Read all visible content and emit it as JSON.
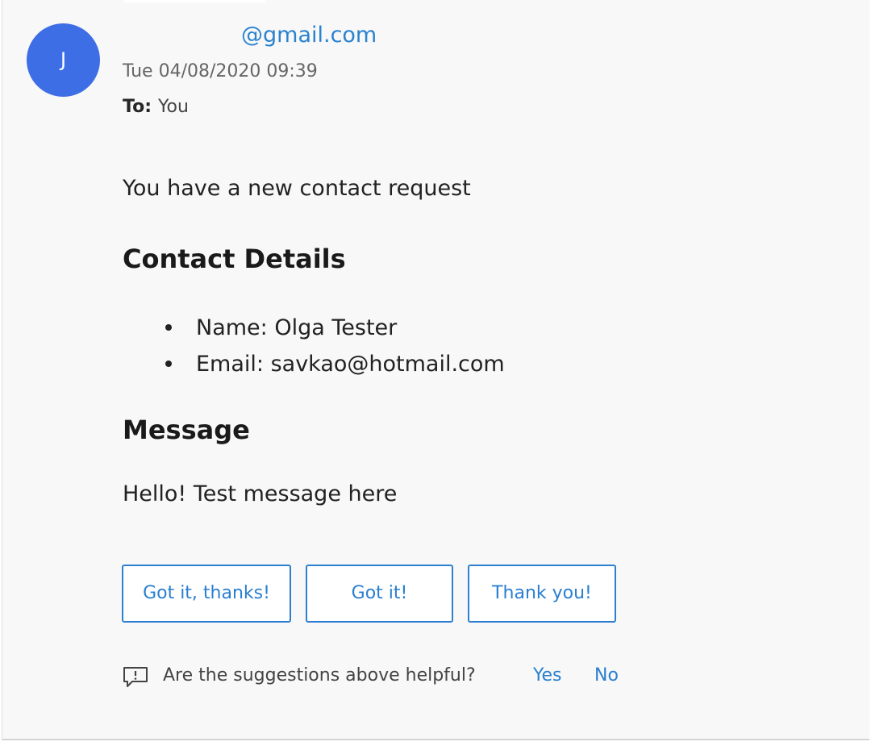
{
  "header": {
    "avatar_initial": "J",
    "sender": "@gmail.com",
    "date": "Tue 04/08/2020 09:39",
    "to_label": "To:",
    "to_value": "You"
  },
  "body": {
    "intro": "You have a new contact request",
    "contact_heading": "Contact Details",
    "details": [
      "Name: Olga Tester",
      "Email: savkao@hotmail.com"
    ],
    "message_heading": "Message",
    "message": "Hello! Test message here"
  },
  "suggested_replies": [
    "Got it, thanks!",
    "Got it!",
    "Thank you!"
  ],
  "feedback": {
    "icon": "feedback-icon",
    "question": "Are the suggestions above helpful?",
    "yes": "Yes",
    "no": "No"
  },
  "colors": {
    "avatar": "#3d6ee6",
    "link": "#2a7fd0",
    "background": "#f8f8f8"
  }
}
